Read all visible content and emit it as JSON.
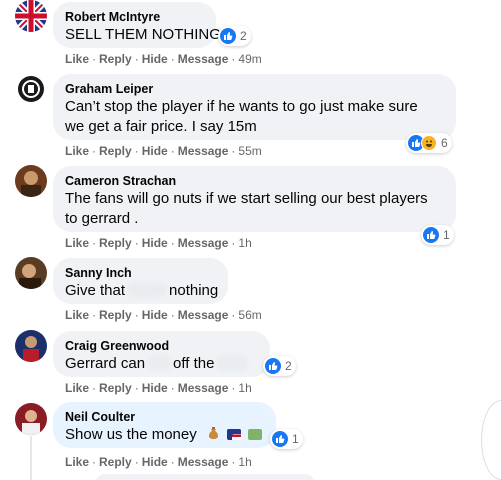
{
  "actions": {
    "like": "Like",
    "reply": "Reply",
    "hide": "Hide",
    "message": "Message",
    "dot": "·"
  },
  "comments": [
    {
      "author": "Robert McIntyre",
      "text": "SELL THEM NOTHING",
      "time": "49m",
      "reactions": {
        "types": [
          "like"
        ],
        "count": "2"
      }
    },
    {
      "author": "Graham Leiper",
      "text_lines": [
        "Can’t stop the player if he wants to go just make sure",
        "we get a fair price. I say 15m"
      ],
      "time": "55m",
      "reactions": {
        "types": [
          "like",
          "haha"
        ],
        "count": "6"
      }
    },
    {
      "author": "Cameron Strachan",
      "text_lines": [
        "The fans will go nuts if we start selling our best players",
        "to gerrard ."
      ],
      "time": "1h",
      "reactions": {
        "types": [
          "like"
        ],
        "count": "1"
      }
    },
    {
      "author": "Sanny Inch",
      "text_parts": [
        "Give that",
        "nothing"
      ],
      "time": "56m"
    },
    {
      "author": "Craig Greenwood",
      "text_parts": [
        "Gerrard can",
        "off the"
      ],
      "time": "1h",
      "reactions": {
        "types": [
          "like"
        ],
        "count": "2"
      }
    },
    {
      "author": "Neil Coulter",
      "text": "Show us the money",
      "time": "1h",
      "reactions": {
        "types": [
          "like"
        ],
        "count": "1"
      }
    }
  ],
  "colors": {
    "bubble": "#f0f2f5",
    "bubble_highlight": "#e7f3ff",
    "like_blue": "#1877f2",
    "meta_gray": "#65676b"
  },
  "icons": [
    "union-jack-avatar",
    "club-crest-avatar",
    "like-icon",
    "haha-icon",
    "money-bag-emoji",
    "flag-emoji",
    "banknote-emoji"
  ]
}
